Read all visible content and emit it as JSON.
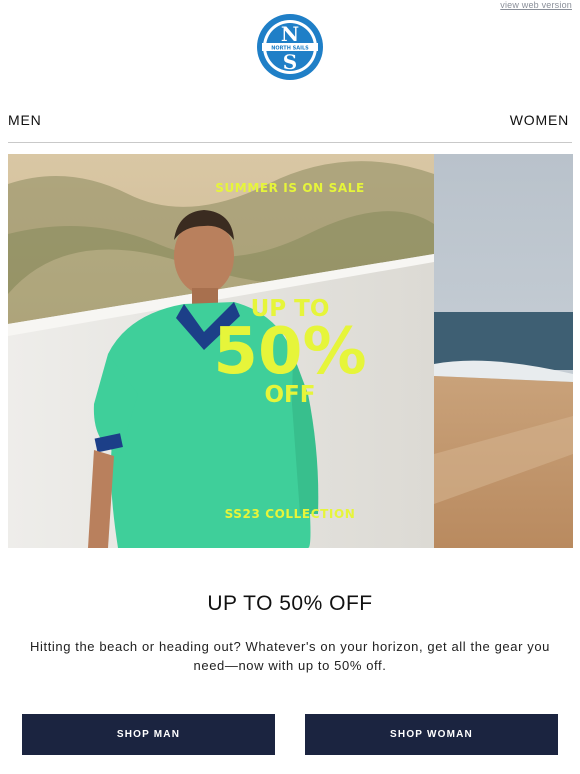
{
  "header": {
    "view_web_version": "view web version",
    "logo": {
      "top": "N",
      "bottom": "S",
      "ring_text": "NORTH SAILS",
      "color": "#1f7fc7"
    }
  },
  "nav": {
    "men_label": "MEN",
    "women_label": "WOMEN"
  },
  "hero": {
    "tagline": "SUMMER IS ON SALE",
    "headline_line1": "UP TO",
    "headline_line2": "50%",
    "headline_line3": "OFF",
    "collection": "SS23 COLLECTION",
    "accent_color": "#e6f53a",
    "shirt_color": "#3fcf9a"
  },
  "main": {
    "title": "UP TO 50% OFF",
    "body": "Hitting the beach or heading out? Whatever's on your horizon, get all the gear you need—now with up to 50% off."
  },
  "buttons": {
    "shop_man": "SHOP MAN",
    "shop_woman": "SHOP WOMAN",
    "bg_color": "#1b2440"
  }
}
